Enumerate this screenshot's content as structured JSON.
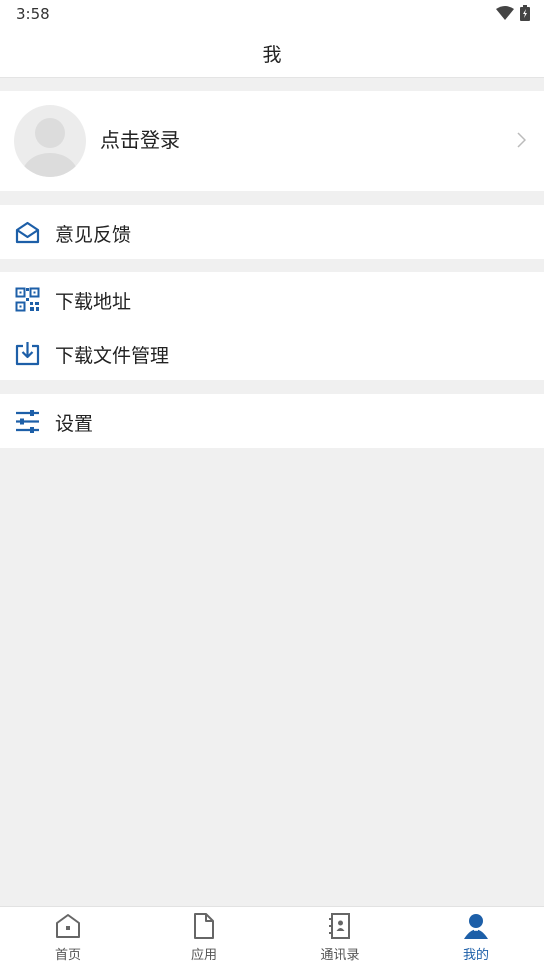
{
  "status": {
    "time": "3:58"
  },
  "header": {
    "title": "我"
  },
  "profile": {
    "login_text": "点击登录"
  },
  "menu": {
    "feedback": "意见反馈",
    "download_address": "下载地址",
    "download_files": "下载文件管理",
    "settings": "设置"
  },
  "tabs": [
    {
      "label": "首页",
      "icon": "home-icon"
    },
    {
      "label": "应用",
      "icon": "document-icon"
    },
    {
      "label": "通讯录",
      "icon": "contacts-icon"
    },
    {
      "label": "我的",
      "icon": "person-icon",
      "active": true
    }
  ],
  "colors": {
    "accent": "#1d5fa8",
    "background": "#f0f0f0"
  }
}
